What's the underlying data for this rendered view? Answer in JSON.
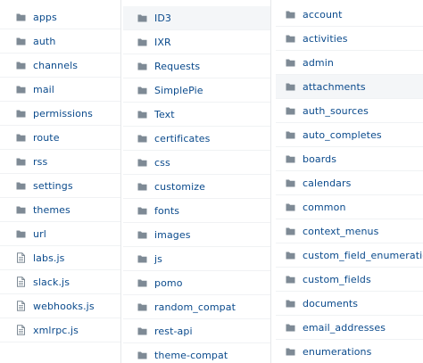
{
  "colors": {
    "link": "#0a4a8c",
    "folder_icon": "#7e8a95",
    "file_icon": "#7e8a95",
    "highlight": "#f4f6f8",
    "divider": "#e6e8ea"
  },
  "columns": [
    {
      "items": [
        {
          "label": "apps",
          "icon": "folder-icon"
        },
        {
          "label": "auth",
          "icon": "folder-icon"
        },
        {
          "label": "channels",
          "icon": "folder-icon"
        },
        {
          "label": "mail",
          "icon": "folder-icon"
        },
        {
          "label": "permissions",
          "icon": "folder-icon"
        },
        {
          "label": "route",
          "icon": "folder-icon"
        },
        {
          "label": "rss",
          "icon": "folder-icon"
        },
        {
          "label": "settings",
          "icon": "folder-icon"
        },
        {
          "label": "themes",
          "icon": "folder-icon"
        },
        {
          "label": "url",
          "icon": "folder-icon"
        },
        {
          "label": "labs.js",
          "icon": "file-icon"
        },
        {
          "label": "slack.js",
          "icon": "file-icon"
        },
        {
          "label": "webhooks.js",
          "icon": "file-icon"
        },
        {
          "label": "xmlrpc.js",
          "icon": "file-icon"
        }
      ]
    },
    {
      "items": [
        {
          "label": "ID3",
          "icon": "folder-icon",
          "highlighted": true
        },
        {
          "label": "IXR",
          "icon": "folder-icon"
        },
        {
          "label": "Requests",
          "icon": "folder-icon"
        },
        {
          "label": "SimplePie",
          "icon": "folder-icon"
        },
        {
          "label": "Text",
          "icon": "folder-icon"
        },
        {
          "label": "certificates",
          "icon": "folder-icon"
        },
        {
          "label": "css",
          "icon": "folder-icon"
        },
        {
          "label": "customize",
          "icon": "folder-icon"
        },
        {
          "label": "fonts",
          "icon": "folder-icon"
        },
        {
          "label": "images",
          "icon": "folder-icon"
        },
        {
          "label": "js",
          "icon": "folder-icon"
        },
        {
          "label": "pomo",
          "icon": "folder-icon"
        },
        {
          "label": "random_compat",
          "icon": "folder-icon"
        },
        {
          "label": "rest-api",
          "icon": "folder-icon"
        },
        {
          "label": "theme-compat",
          "icon": "folder-icon"
        }
      ]
    },
    {
      "items": [
        {
          "label": "account",
          "icon": "folder-icon"
        },
        {
          "label": "activities",
          "icon": "folder-icon"
        },
        {
          "label": "admin",
          "icon": "folder-icon"
        },
        {
          "label": "attachments",
          "icon": "folder-icon",
          "highlighted": true
        },
        {
          "label": "auth_sources",
          "icon": "folder-icon"
        },
        {
          "label": "auto_completes",
          "icon": "folder-icon"
        },
        {
          "label": "boards",
          "icon": "folder-icon"
        },
        {
          "label": "calendars",
          "icon": "folder-icon"
        },
        {
          "label": "common",
          "icon": "folder-icon"
        },
        {
          "label": "context_menus",
          "icon": "folder-icon"
        },
        {
          "label": "custom_field_enumerations",
          "icon": "folder-icon"
        },
        {
          "label": "custom_fields",
          "icon": "folder-icon"
        },
        {
          "label": "documents",
          "icon": "folder-icon"
        },
        {
          "label": "email_addresses",
          "icon": "folder-icon"
        },
        {
          "label": "enumerations",
          "icon": "folder-icon"
        }
      ]
    }
  ]
}
